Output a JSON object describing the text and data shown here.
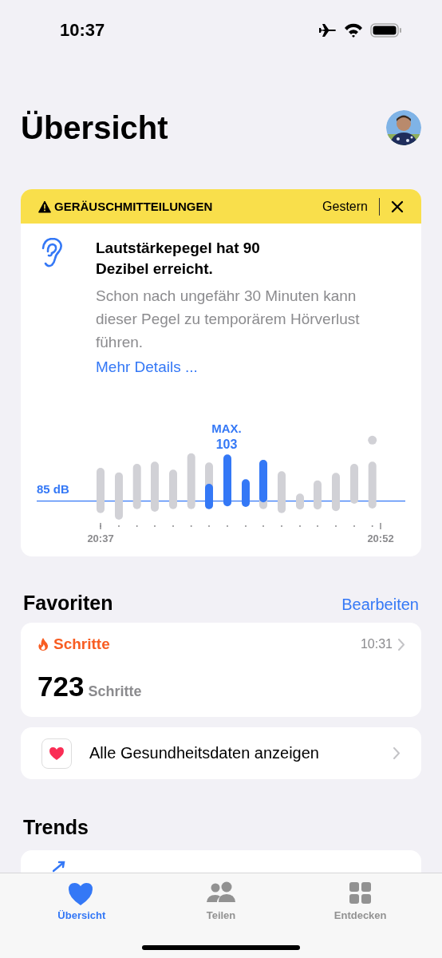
{
  "status_bar": {
    "time": "10:37"
  },
  "header": {
    "title": "Übersicht"
  },
  "alert": {
    "category": "GERÄUSCHMITTEILUNGEN",
    "time": "Gestern",
    "title": "Lautstärkepegel hat 90 Dezibel erreicht.",
    "body": "Schon nach ungefähr 30 Minuten kann dieser Pegel zu temporärem Hörverlust führen.",
    "link": "Mehr Details ...",
    "chart": {
      "threshold_label": "85 dB",
      "max_label": "MAX.",
      "max_value": "103",
      "start_time": "20:37",
      "end_time": "20:52"
    }
  },
  "favorites": {
    "title": "Favoriten",
    "action": "Bearbeiten",
    "items": [
      {
        "kind": "metric",
        "name": "Schritte",
        "time": "10:31",
        "value": "723",
        "unit": "Schritte"
      },
      {
        "kind": "link",
        "label": "Alle Gesundheitsdaten anzeigen"
      }
    ]
  },
  "trends": {
    "title": "Trends"
  },
  "tab_bar": [
    {
      "label": "Übersicht",
      "selected": true
    },
    {
      "label": "Teilen",
      "selected": false
    },
    {
      "label": "Entdecken",
      "selected": false
    }
  ]
}
